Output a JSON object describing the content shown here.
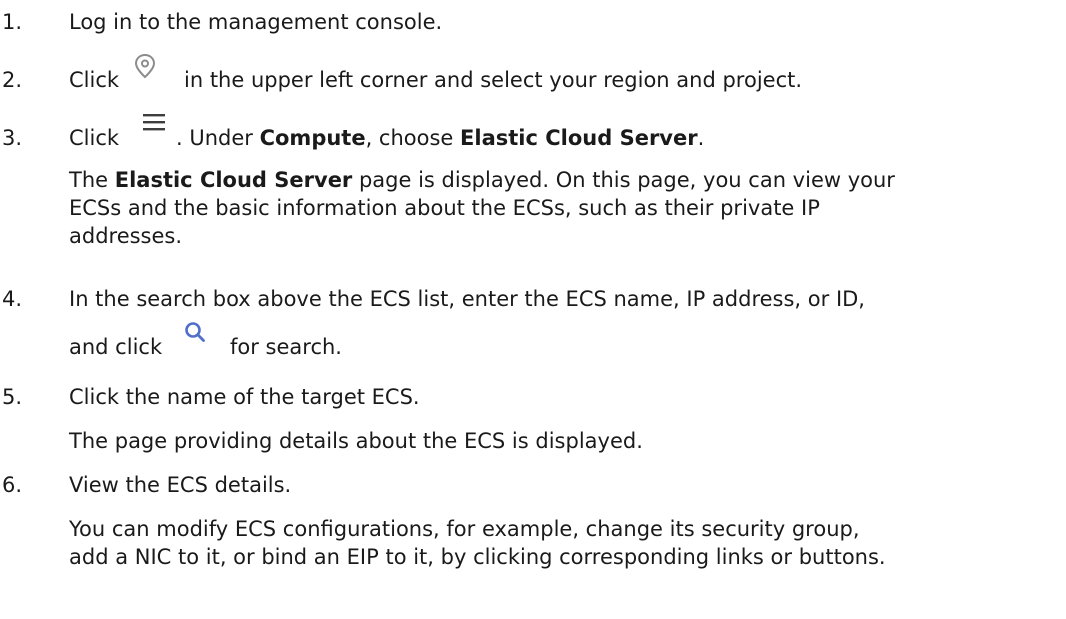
{
  "steps": [
    {
      "number": "1.",
      "text": "Log in to the management console."
    },
    {
      "number": "2.",
      "text_before": "Click",
      "icon": "location-pin-icon",
      "text_after": "in the upper left corner and select your region and project."
    },
    {
      "number": "3.",
      "text_before": "Click",
      "icon": "menu-hamburger-icon",
      "text_after_1": ". Under ",
      "bold_1": "Compute",
      "text_after_2": ", choose ",
      "bold_2": "Elastic Cloud Server",
      "text_after_3": ".",
      "note": {
        "prefix": "The ",
        "bold": "Elastic Cloud Server",
        "line_1_rest": " page is displayed. On this page, you can view your",
        "line_2": "ECSs and the basic information about the ECSs, such as their private IP",
        "line_3": "addresses."
      }
    },
    {
      "number": "4.",
      "line_1": "In the search box above the ECS list, enter the ECS name, IP address, or ID,",
      "line_2_before": "and click",
      "icon": "search-icon",
      "line_2_after": "for search."
    },
    {
      "number": "5.",
      "text": "Click the name of the target ECS.",
      "note": "The page providing details about the ECS is displayed."
    },
    {
      "number": "6.",
      "text": "View the ECS details.",
      "note_line_1": "You can modify ECS configurations, for example, change its security group,",
      "note_line_2": "add a NIC to it, or bind an EIP to it, by clicking corresponding links or buttons."
    }
  ],
  "colors": {
    "text": "#1a1a1a",
    "icon_gray": "#8c8c8c",
    "icon_dark": "#3d3d3d",
    "icon_blue": "#526ecc"
  }
}
